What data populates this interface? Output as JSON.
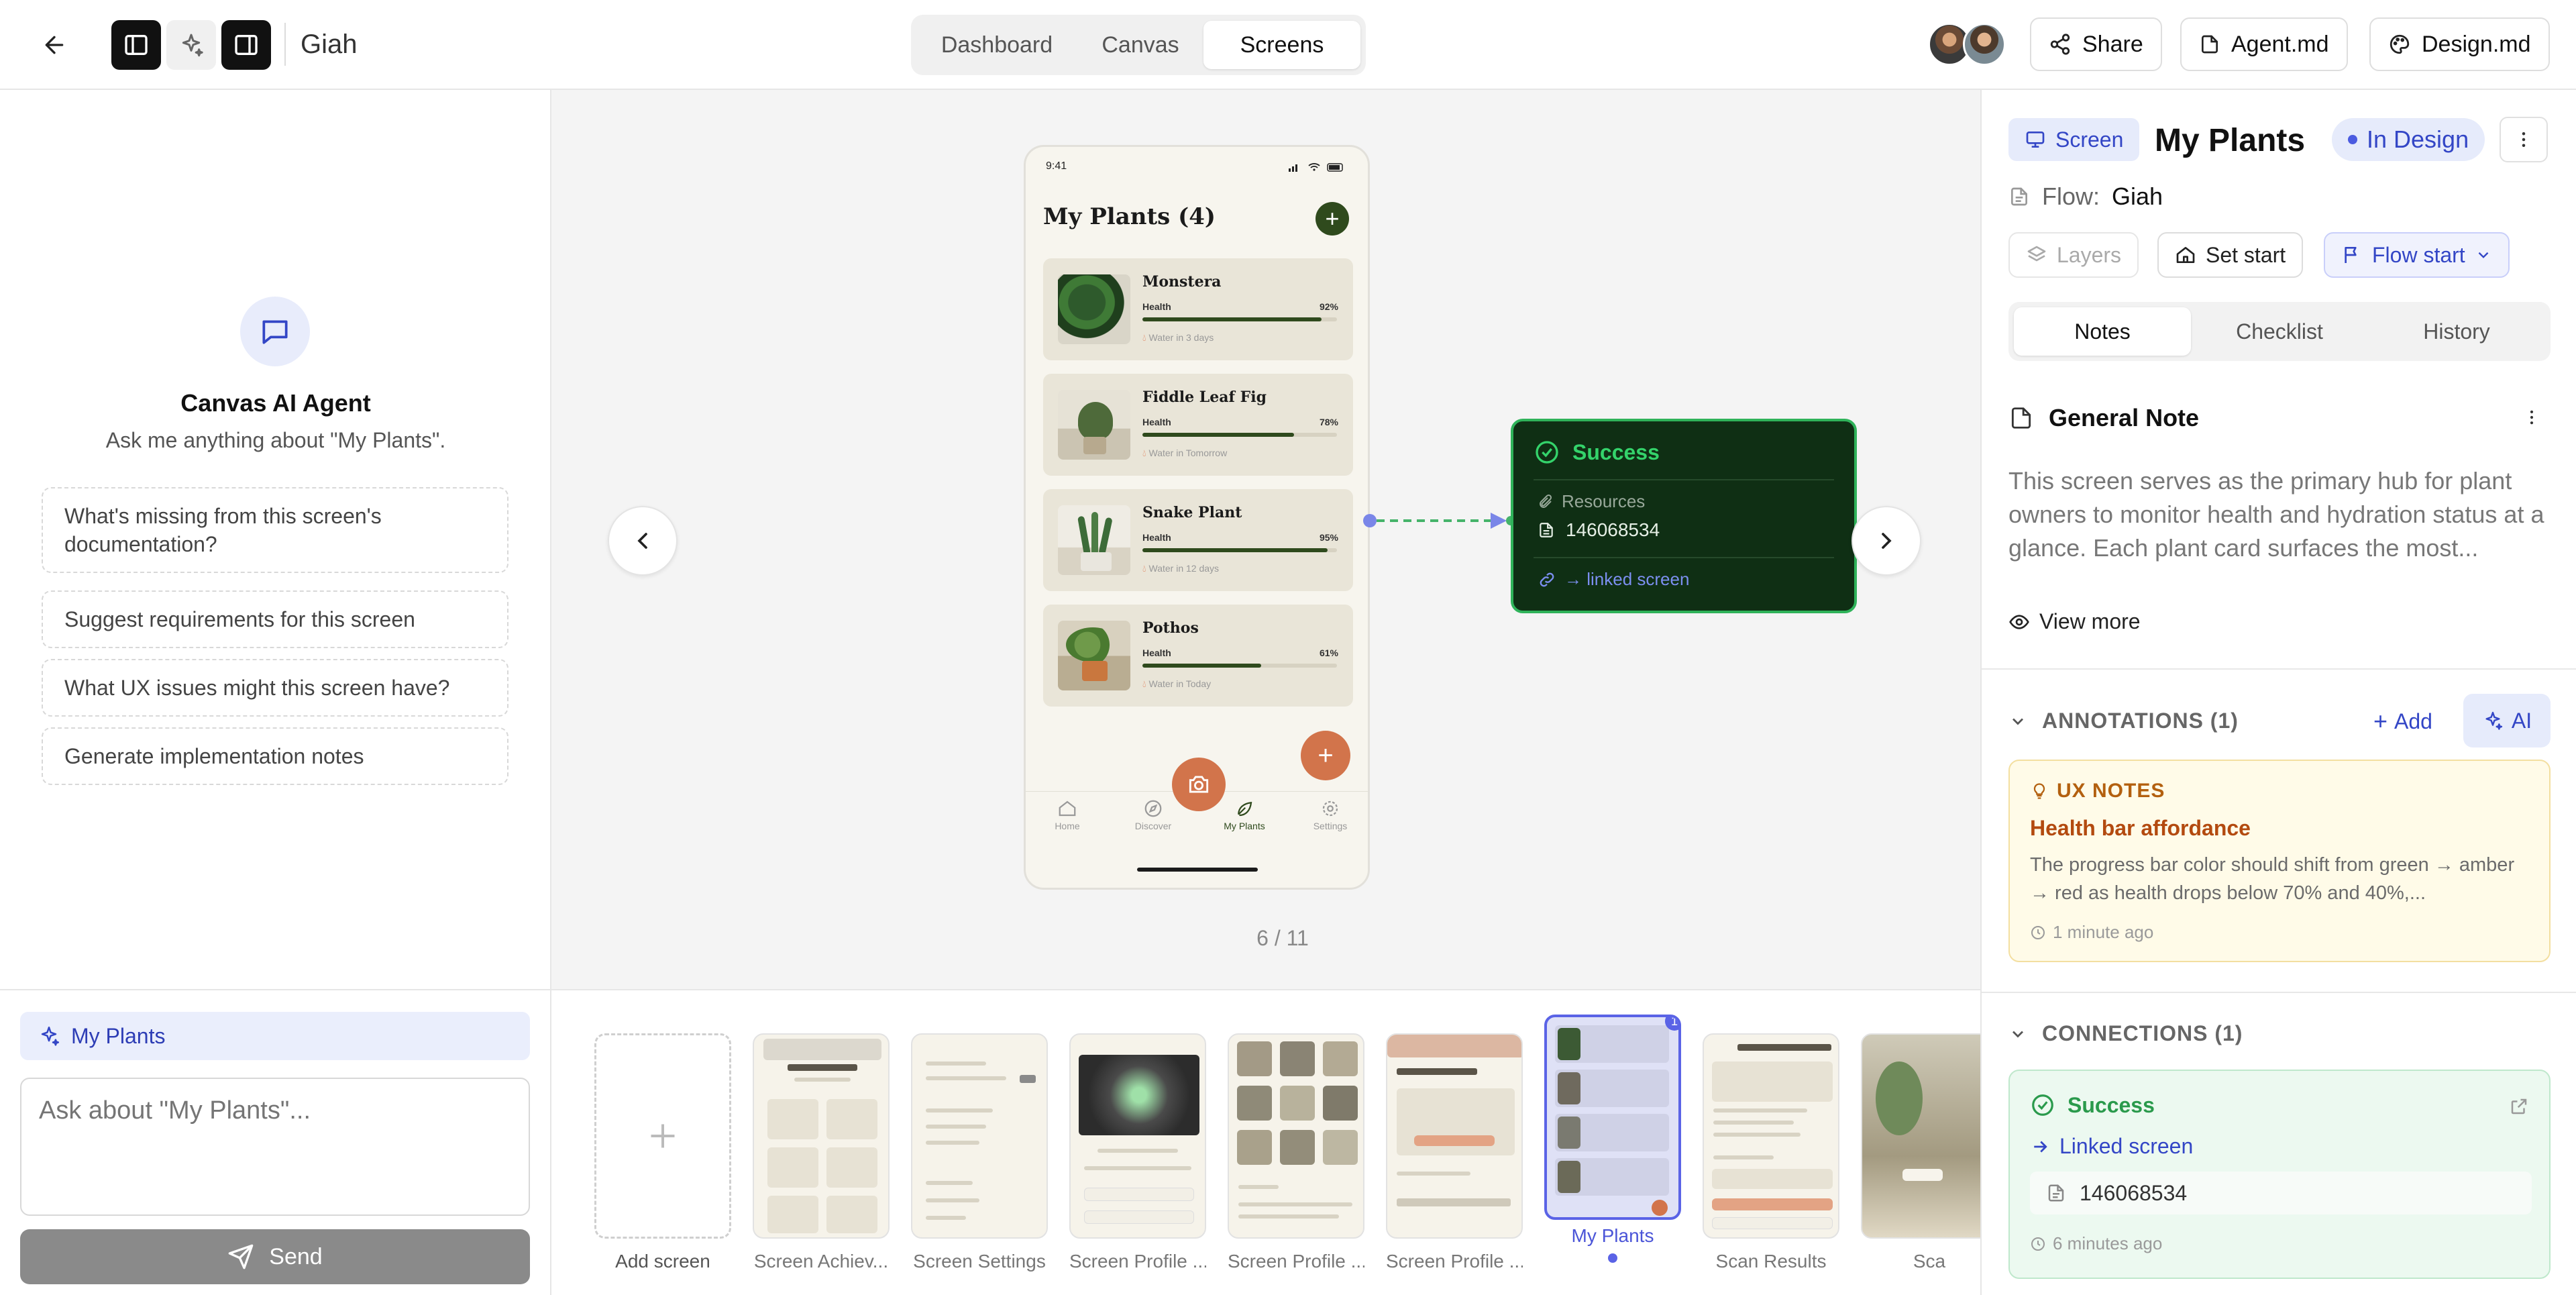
{
  "topbar": {
    "project_name": "Giah",
    "view_tabs": [
      "Dashboard",
      "Canvas",
      "Screens"
    ],
    "active_tab": "Screens",
    "share_label": "Share",
    "agent_md_label": "Agent.md",
    "design_md_label": "Design.md"
  },
  "agent": {
    "title": "Canvas AI Agent",
    "subtitle": "Ask me anything about \"My Plants\".",
    "suggestions": [
      "What's missing from this screen's documentation?",
      "Suggest requirements for this screen",
      "What UX issues might this screen have?",
      "Generate implementation notes"
    ],
    "context_chip": "My Plants",
    "input_placeholder": "Ask about \"My Plants\"...",
    "send_label": "Send"
  },
  "canvas": {
    "counter": "6 / 11",
    "phone": {
      "time": "9:41",
      "title": "My Plants (4)",
      "plants": [
        {
          "name": "Monstera",
          "health_label": "Health",
          "health_pct": "92%",
          "health_value": 0.92,
          "water": "Water in 3 days"
        },
        {
          "name": "Fiddle Leaf Fig",
          "health_label": "Health",
          "health_pct": "78%",
          "health_value": 0.78,
          "water": "Water in Tomorrow"
        },
        {
          "name": "Snake Plant",
          "health_label": "Health",
          "health_pct": "95%",
          "health_value": 0.95,
          "water": "Water in 12 days"
        },
        {
          "name": "Pothos",
          "health_label": "Health",
          "health_pct": "61%",
          "health_value": 0.61,
          "water": "Water in Today"
        }
      ],
      "tabs": [
        "Home",
        "Discover",
        "My Plants",
        "Settings"
      ]
    },
    "success_node": {
      "title": "Success",
      "resources_label": "Resources",
      "resource_id": "146068534",
      "link_label": "→ linked screen"
    }
  },
  "filmstrip": {
    "add_label": "Add screen",
    "screens": [
      {
        "label": "Screen Achiev..."
      },
      {
        "label": "Screen Settings"
      },
      {
        "label": "Screen Profile ..."
      },
      {
        "label": "Screen Profile ..."
      },
      {
        "label": "Screen Profile ..."
      },
      {
        "label": "My Plants",
        "selected": true,
        "badge": "1"
      },
      {
        "label": "Scan Results"
      },
      {
        "label": "Sca"
      }
    ]
  },
  "details": {
    "screen_chip": "Screen",
    "title": "My Plants",
    "status": "In Design",
    "flow_label": "Flow:",
    "flow_value": "Giah",
    "layers_label": "Layers",
    "set_start_label": "Set start",
    "flow_start_label": "Flow start",
    "tabs": [
      "Notes",
      "Checklist",
      "History"
    ],
    "active_tab": "Notes",
    "note": {
      "title": "General Note",
      "body": "This screen serves as the primary hub for plant owners to monitor health and hydration status at a glance. Each plant card surfaces the most...",
      "view_more": "View more"
    },
    "annotations": {
      "header": "ANNOTATIONS (1)",
      "add_label": "Add",
      "ai_label": "AI",
      "card": {
        "tag": "UX NOTES",
        "title": "Health bar affordance",
        "body": "The progress bar color should shift from green → amber → red as health drops below 70% and 40%,...",
        "time": "1 minute ago"
      }
    },
    "connections": {
      "header": "CONNECTIONS (1)",
      "card": {
        "title": "Success",
        "link": "Linked screen",
        "id": "146068534",
        "time": "6 minutes ago"
      }
    }
  },
  "colors": {
    "accent": "#3346c6",
    "success": "#2fb35a",
    "plant_green": "#2f4a1d",
    "terracotta": "#d2744b"
  }
}
